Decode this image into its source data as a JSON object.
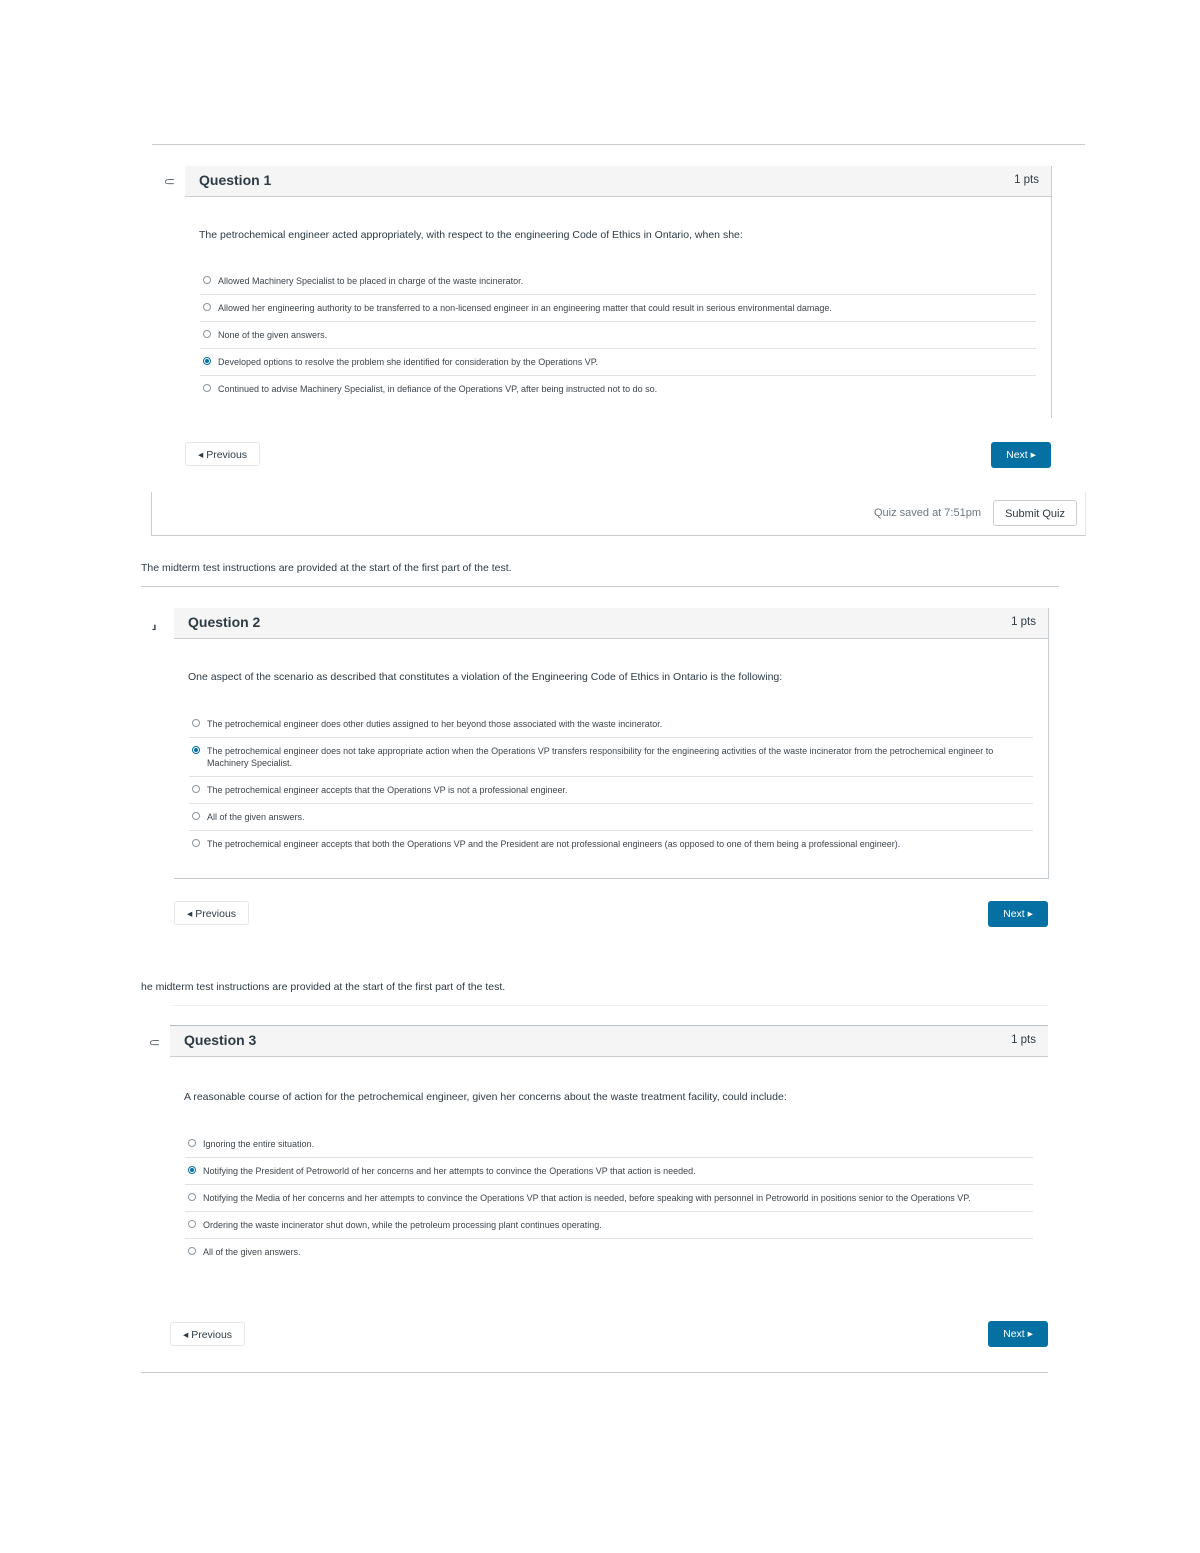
{
  "questions": [
    {
      "title": "Question 1",
      "points": "1 pts",
      "text": "The petrochemical engineer acted appropriately, with respect to the engineering Code of Ethics in Ontario, when she:",
      "answers": [
        "Allowed Machinery Specialist to be placed in charge of the waste incinerator.",
        "Allowed her engineering authority to be transferred to a non-licensed engineer in an engineering matter that could result in serious environmental damage.",
        "None of the given answers.",
        "Developed options to resolve the problem she identified for consideration by the Operations VP.",
        "Continued to advise Machinery Specialist, in defiance of the Operations VP, after being instructed not to do so."
      ],
      "selected_index": 3,
      "prev_label": "◂ Previous",
      "next_label": "Next ▸"
    },
    {
      "title": "Question 2",
      "points": "1 pts",
      "text": "One aspect of the scenario as described that constitutes a violation of the Engineering Code of Ethics in Ontario is the following:",
      "answers": [
        "The petrochemical engineer does other duties assigned to her beyond those associated with the waste incinerator.",
        "The petrochemical engineer does not take appropriate action when the Operations VP transfers responsibility for the engineering activities of the waste incinerator from the petrochemical engineer to Machinery Specialist.",
        "The petrochemical engineer accepts that the Operations VP is not a professional engineer.",
        "All of the given answers.",
        "The petrochemical engineer accepts that both the Operations VP and the President are not professional engineers (as opposed to one of them being a professional engineer)."
      ],
      "selected_index": 1,
      "prev_label": "◂ Previous",
      "next_label": "Next ▸"
    },
    {
      "title": "Question 3",
      "points": "1 pts",
      "text": "A reasonable course of action for the petrochemical engineer, given her concerns about the waste treatment facility, could include:",
      "answers": [
        "Ignoring the entire situation.",
        "Notifying the President of Petroworld of her concerns and her attempts to convince the Operations VP that action is needed.",
        "Notifying the Media of her concerns and her attempts to convince the Operations VP that action is needed, before speaking with personnel in Petroworld in positions senior to the Operations VP.",
        "Ordering the waste incinerator shut down, while the petroleum processing plant continues operating.",
        "All of the given answers."
      ],
      "selected_index": 1,
      "prev_label": "◂ Previous",
      "next_label": "Next ▸"
    }
  ],
  "quiz_footer": {
    "saved_text": "Quiz saved at 7:51pm",
    "submit_label": "Submit Quiz"
  },
  "instructions_note": {
    "first": "The midterm test instructions are provided at the start of the first part of the test.",
    "second": "he midterm test instructions are provided at the start of the first part of the test."
  },
  "icons": {
    "flag": "bookmark-flag-icon"
  },
  "colors": {
    "primary": "#0770a3",
    "header_bg": "#f5f5f5",
    "text": "#2d3b45",
    "border": "#c7cdd1"
  }
}
